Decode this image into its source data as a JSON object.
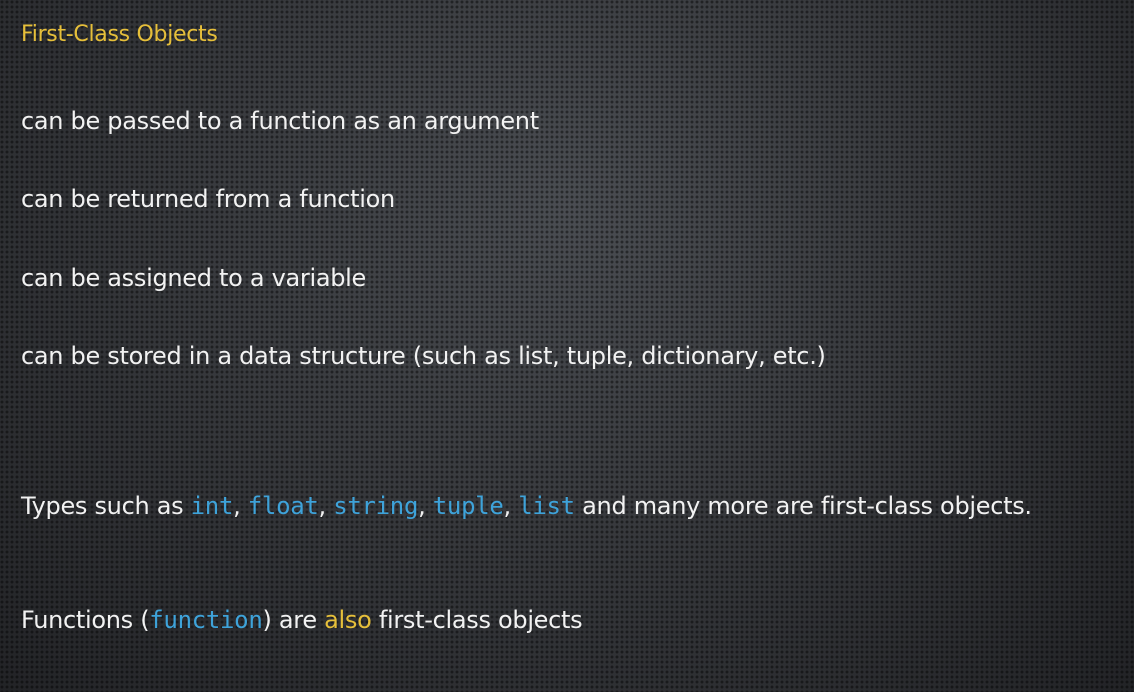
{
  "title": "First-Class Objects",
  "bullets": [
    "can be passed to a function as an argument",
    "can be returned from a function",
    "can be assigned to a variable",
    "can be stored in a data structure (such as list, tuple, dictionary, etc.)"
  ],
  "types_line": {
    "prefix": "Types such as ",
    "types": [
      "int",
      "float",
      "string",
      "tuple",
      "list"
    ],
    "sep": ", ",
    "suffix": " and many more are first-class objects."
  },
  "functions_line": {
    "prefix": "Functions (",
    "code": "function",
    "mid": ") are ",
    "highlight": "also",
    "suffix": " first-class objects"
  },
  "colors": {
    "title": "#e6bf3a",
    "code": "#3ea3da",
    "highlight": "#e6bf3a"
  }
}
